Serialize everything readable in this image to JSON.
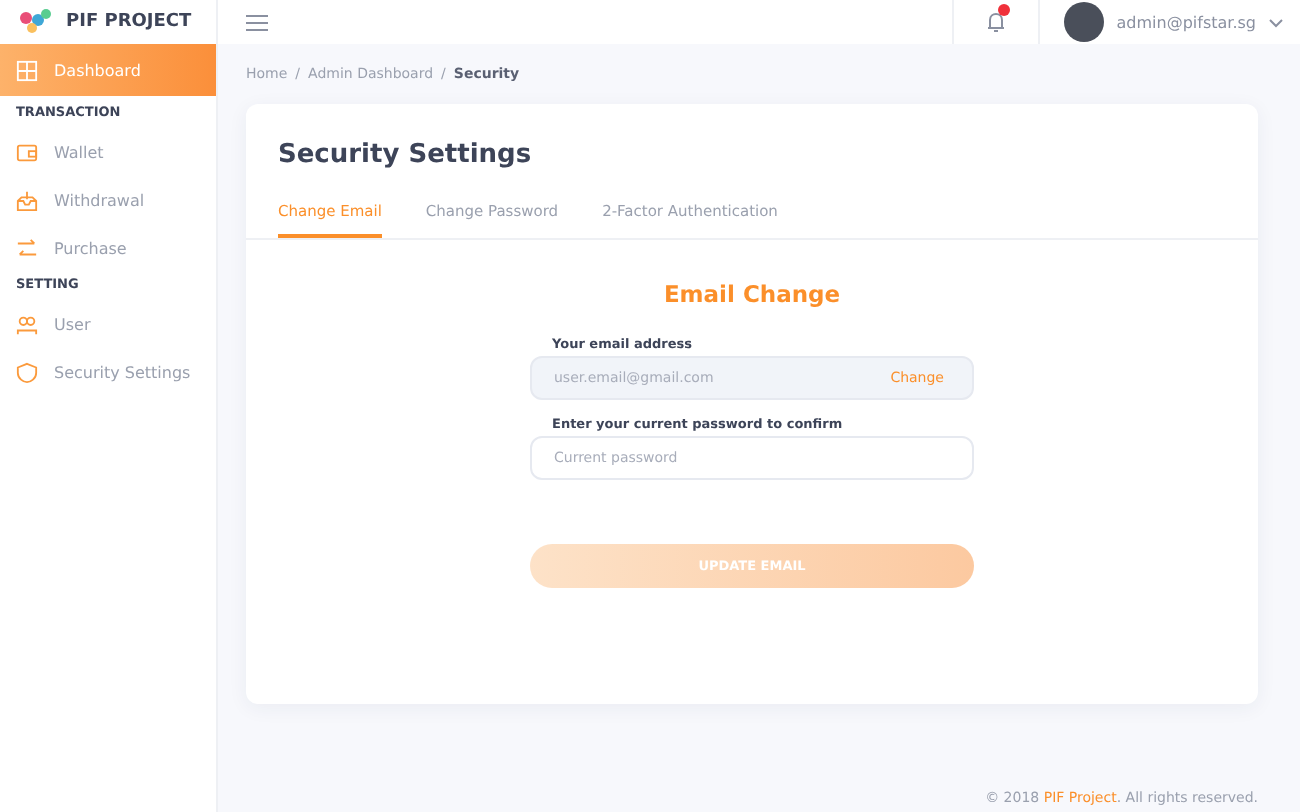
{
  "brand": {
    "name": "PIF PROJECT"
  },
  "header": {
    "notification": {
      "unread": true
    },
    "user": {
      "email": "admin@pifstar.sg"
    }
  },
  "sidebar": {
    "items": [
      {
        "kind": "link",
        "label": "Dashboard",
        "selected": true
      },
      {
        "kind": "heading",
        "label": "TRANSACTION"
      },
      {
        "kind": "link",
        "label": "Wallet",
        "selected": false
      },
      {
        "kind": "link",
        "label": "Withdrawal",
        "selected": false
      },
      {
        "kind": "link",
        "label": "Purchase",
        "selected": false
      },
      {
        "kind": "heading",
        "label": "SETTING"
      },
      {
        "kind": "link",
        "label": "User",
        "selected": false
      },
      {
        "kind": "link",
        "label": "Security Settings",
        "selected": false
      }
    ]
  },
  "breadcrumb": {
    "separator": "/",
    "items": [
      {
        "label": "Home",
        "current": false
      },
      {
        "label": "Admin Dashboard",
        "current": false
      },
      {
        "label": "Security",
        "current": true
      }
    ]
  },
  "card": {
    "title": "Security Settings",
    "tabs": [
      {
        "label": "Change Email",
        "selected": true
      },
      {
        "label": "Change Password",
        "selected": false
      },
      {
        "label": "2-Factor Authentication",
        "selected": false
      }
    ],
    "form": {
      "title": "Email Change",
      "email_label": "Your email address",
      "email_value": "user.email@gmail.com",
      "change_link": "Change",
      "password_label": "Enter your current password to confirm",
      "password_placeholder": "Current password",
      "submit": {
        "label": "UPDATE EMAIL",
        "disabled": true
      }
    }
  },
  "footer": {
    "prefix": "© 2018 ",
    "link": "PIF Project",
    "suffix": ". All rights reserved."
  }
}
